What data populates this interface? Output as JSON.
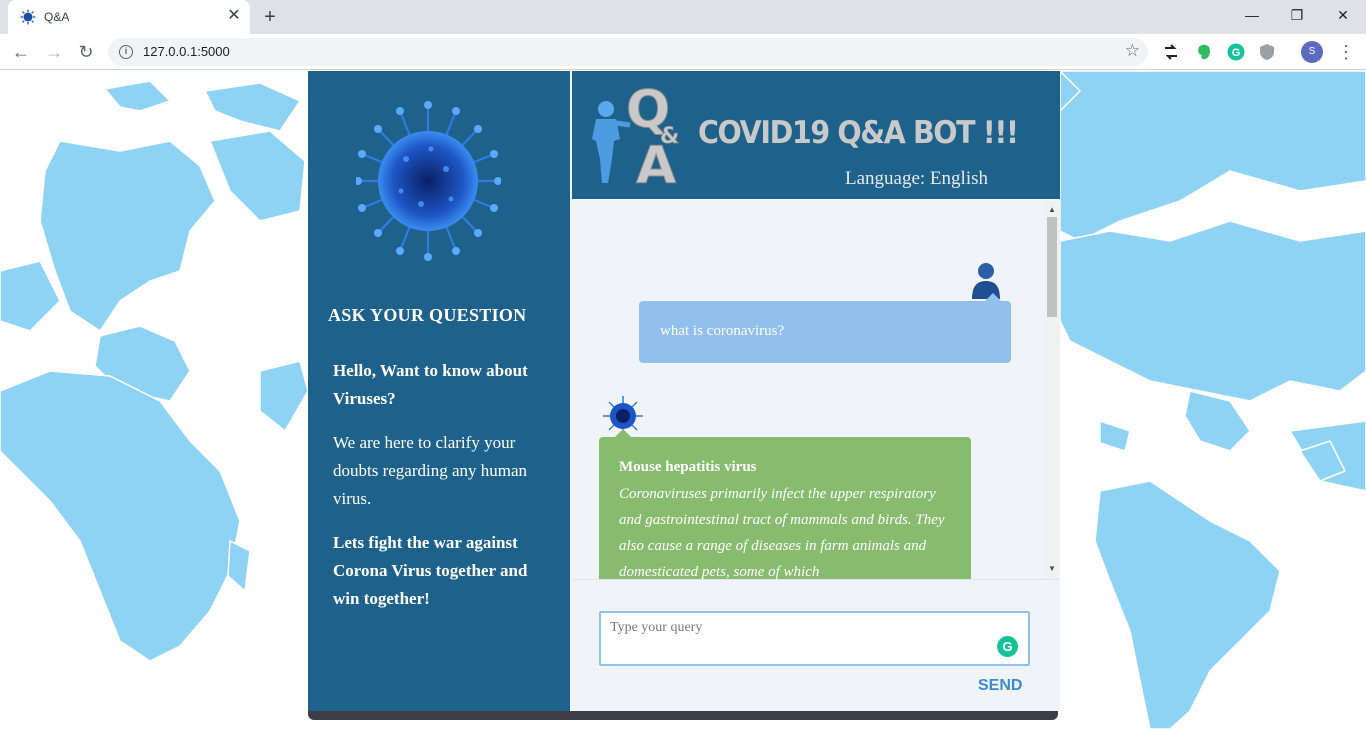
{
  "browser": {
    "tab_title": "Q&A",
    "tab_close": "✕",
    "new_tab": "+",
    "url": "127.0.0.1:5000",
    "profile_initial": "S",
    "window_controls": {
      "minimize": "—",
      "restore": "❐",
      "close": "✕"
    },
    "nav": {
      "back": "←",
      "forward": "→",
      "reload": "↻"
    }
  },
  "sidebar": {
    "title": "ASK YOUR QUESTION",
    "greeting": "Hello, Want to know about Viruses?",
    "intro": "We are here to clarify your doubts regarding any human virus.",
    "motto": "Lets fight the war against Corona Virus together and win together!"
  },
  "header": {
    "logo_q": "Q",
    "logo_amp": "&",
    "logo_a": "A",
    "title": "COVID19 Q&A BOT !!!",
    "language": "Language: English"
  },
  "chat": {
    "messages": [
      {
        "sender": "user",
        "text": "what is coronavirus?"
      },
      {
        "sender": "bot",
        "heading": "Mouse hepatitis virus",
        "body": "Coronaviruses primarily infect the upper respiratory and gastrointestinal tract of mammals and birds. They also cause a range of diseases in farm animals and domesticated pets, some of which"
      }
    ]
  },
  "composer": {
    "placeholder": "Type your query",
    "send_label": "SEND",
    "grammarly_glyph": "G"
  },
  "colors": {
    "panel_blue": "#1e628c",
    "user_bubble": "#92bfec",
    "bot_bubble": "#87bb6e",
    "map_blue": "#8fd3f4",
    "send_blue": "#3a8bd1"
  }
}
